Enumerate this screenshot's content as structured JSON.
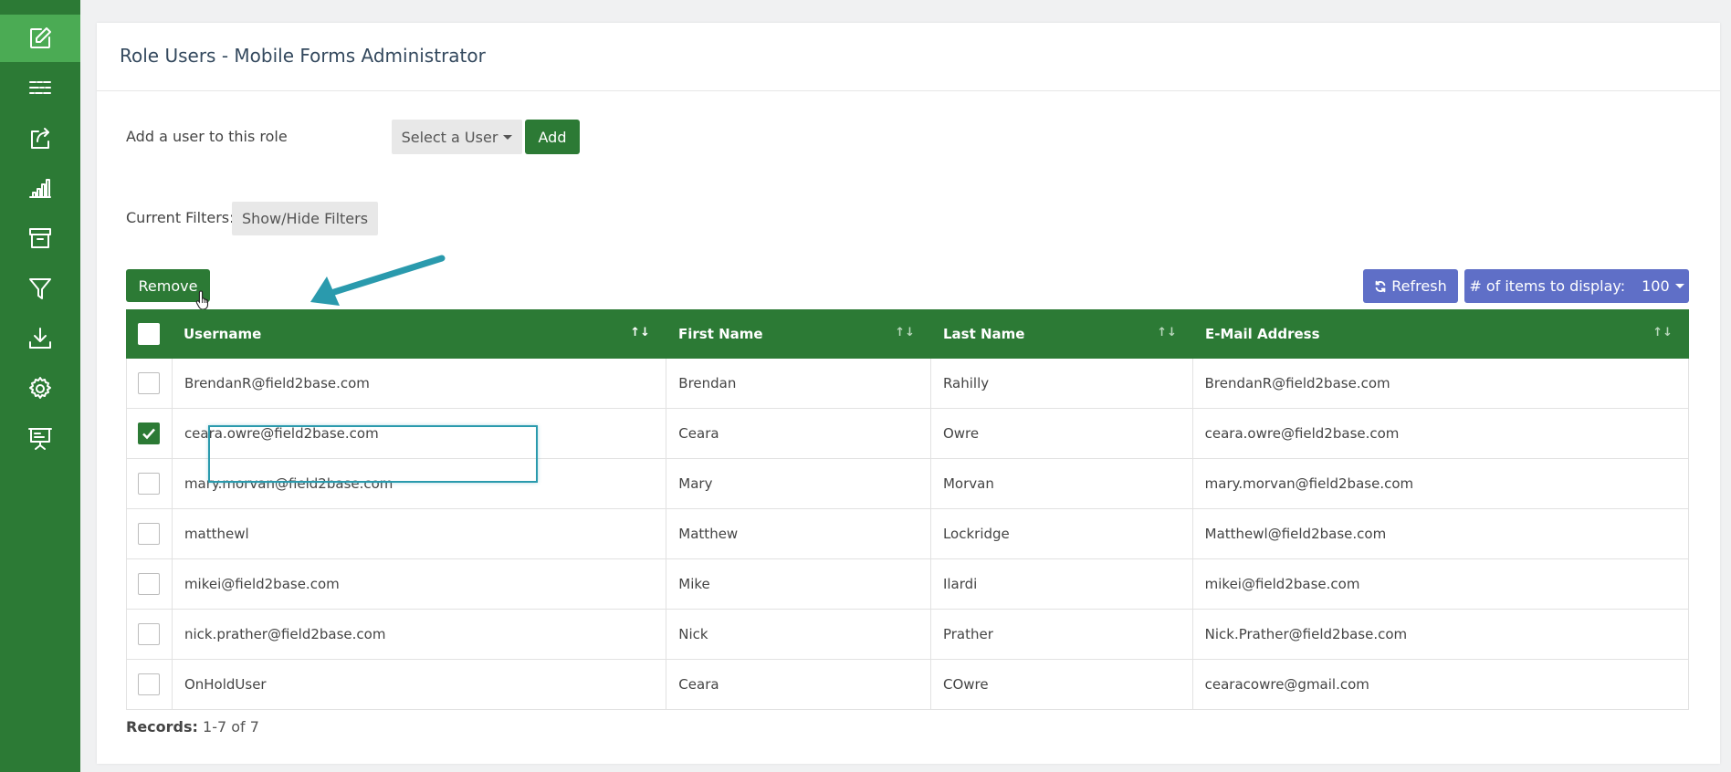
{
  "sidebar": {
    "items": [
      {
        "icon": "edit-icon",
        "active": true
      },
      {
        "icon": "form-fields-icon",
        "active": false
      },
      {
        "icon": "share-export-icon",
        "active": false
      },
      {
        "icon": "bar-chart-icon",
        "active": false
      },
      {
        "icon": "archive-icon",
        "active": false
      },
      {
        "icon": "filter-icon",
        "active": false
      },
      {
        "icon": "download-icon",
        "active": false
      },
      {
        "icon": "gear-icon",
        "active": false
      },
      {
        "icon": "presentation-icon",
        "active": false
      }
    ]
  },
  "page": {
    "title": "Role Users - Mobile Forms Administrator"
  },
  "add_user": {
    "label": "Add a user to this role",
    "select_label": "Select a User",
    "add_label": "Add"
  },
  "filters": {
    "label": "Current Filters:",
    "button_label": "Show/Hide Filters"
  },
  "toolbar": {
    "remove_label": "Remove",
    "refresh_label": "Refresh",
    "items_label": "# of items to display:",
    "items_value": "100"
  },
  "table": {
    "columns": [
      "Username",
      "First Name",
      "Last Name",
      "E-Mail Address"
    ],
    "rows": [
      {
        "checked": false,
        "cells": [
          "BrendanR@field2base.com",
          "Brendan",
          "Rahilly",
          "BrendanR@field2base.com"
        ]
      },
      {
        "checked": true,
        "cells": [
          "ceara.owre@field2base.com",
          "Ceara",
          "Owre",
          "ceara.owre@field2base.com"
        ]
      },
      {
        "checked": false,
        "cells": [
          "mary.morvan@field2base.com",
          "Mary",
          "Morvan",
          "mary.morvan@field2base.com"
        ]
      },
      {
        "checked": false,
        "cells": [
          "matthewl",
          "Matthew",
          "Lockridge",
          "Matthewl@field2base.com"
        ]
      },
      {
        "checked": false,
        "cells": [
          "mikei@field2base.com",
          "Mike",
          "Ilardi",
          "mikei@field2base.com"
        ]
      },
      {
        "checked": false,
        "cells": [
          "nick.prather@field2base.com",
          "Nick",
          "Prather",
          "Nick.Prather@field2base.com"
        ]
      },
      {
        "checked": false,
        "cells": [
          "OnHoldUser",
          "Ceara",
          "COwre",
          "cearacowre@gmail.com"
        ]
      }
    ]
  },
  "records": {
    "label": "Records:",
    "value": "1-7 of 7"
  },
  "colors": {
    "sidebar": "#2c7a35",
    "sidebar_active": "#4bab54",
    "primary": "#2c7a35",
    "info": "#5f6fc7",
    "annotation": "#2a9aad"
  }
}
